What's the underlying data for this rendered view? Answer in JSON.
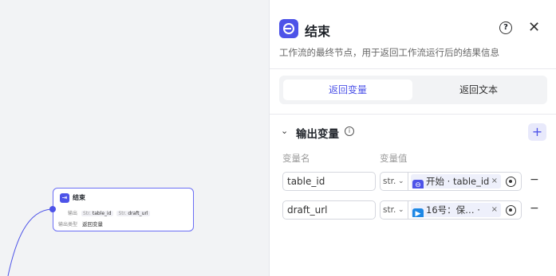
{
  "node": {
    "title": "结束",
    "output_label": "输出",
    "var1_type": "Str.",
    "var1": "table_id",
    "var2_type": "Str.",
    "var2": "draft_url",
    "mode_label": "输出类型",
    "mode_value": "返回变量"
  },
  "panel": {
    "title": "结束",
    "description": "工作流的最终节点，用于返回工作流运行后的结果信息",
    "help_icon": "?",
    "close_icon": "✕",
    "tabs": [
      {
        "label": "返回变量",
        "active": true
      },
      {
        "label": "返回文本",
        "active": false
      }
    ],
    "section_title": "输出变量",
    "info_icon": "i",
    "add_icon": "+",
    "columns": {
      "name": "变量名",
      "value": "变量值"
    },
    "rows": [
      {
        "name": "table_id",
        "type": "str.",
        "ref": "开始 · table_id",
        "ref_color": "#4d53e8",
        "ref_icon": "⊖"
      },
      {
        "name": "draft_url",
        "type": "str.",
        "ref": "16号：保…  ·",
        "ref_color": "#1e88e5",
        "ref_icon": "▶"
      }
    ],
    "remove_icon": "−"
  }
}
